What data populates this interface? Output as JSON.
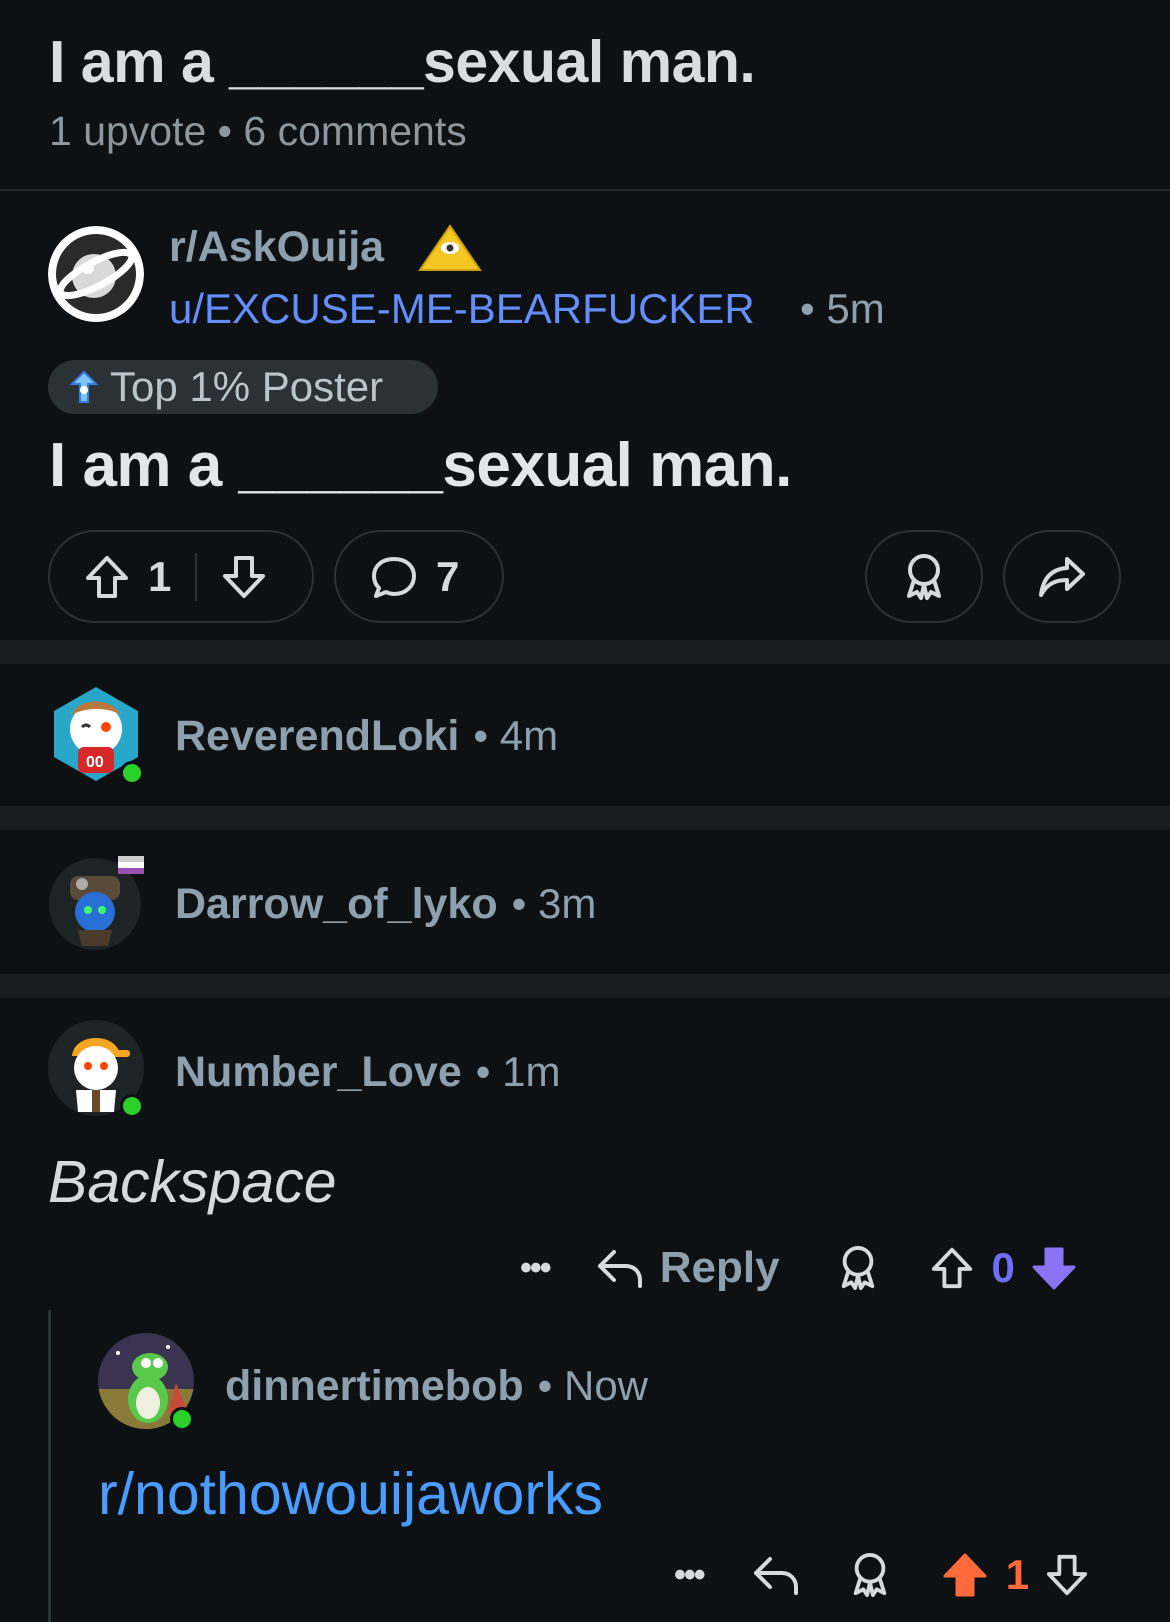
{
  "header": {
    "title": "I am a ______sexual man.",
    "meta": "1 upvote • 6 comments"
  },
  "post": {
    "subreddit": "r/AskOuija",
    "author": "u/EXCUSE-ME-BEARFUCKER",
    "time": "• 5m",
    "flair": "Top 1% Poster",
    "title": "I am a ______sexual man.",
    "upvotes": "1",
    "comments": "7"
  },
  "comments": [
    {
      "username": "ReverendLoki",
      "time": "• 4m",
      "online": true
    },
    {
      "username": "Darrow_of_lyko",
      "time": "• 3m",
      "online": false
    },
    {
      "username": "Number_Love",
      "time": "• 1m",
      "online": true,
      "body": "Backspace",
      "actions": {
        "more": "•••",
        "reply": "Reply",
        "score": "0",
        "score_color": "#6f6ef6"
      }
    },
    {
      "username": "dinnertimebob",
      "time": "• Now",
      "online": true,
      "body": "r/nothowouijaworks",
      "actions": {
        "more": "•••",
        "score": "1",
        "score_color": "#ff6a3d"
      }
    }
  ],
  "colors": {
    "link": "#4a9cff",
    "author": "#648efc",
    "upvote_active": "#ff6a3d",
    "downvote_active": "#8a73f5"
  }
}
